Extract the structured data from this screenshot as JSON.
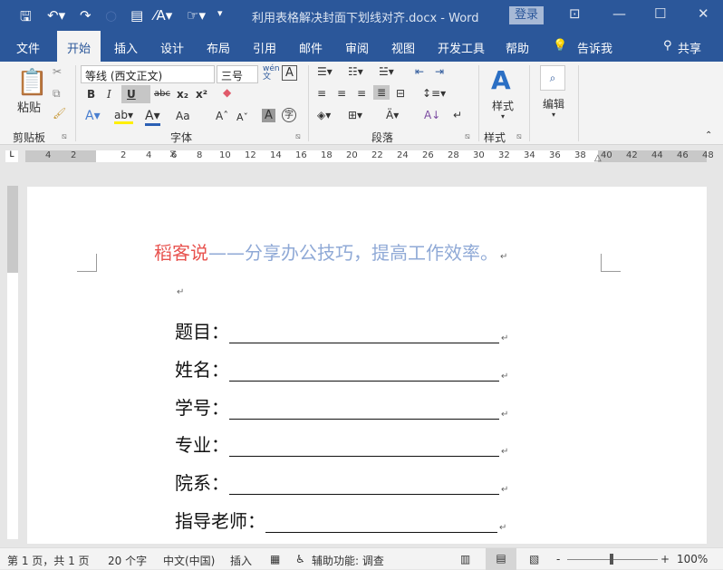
{
  "titlebar": {
    "doc_title": "利用表格解决封面下划线对齐.docx  -  Word",
    "login": "登录",
    "min": "—",
    "max": "☐",
    "close": "✕"
  },
  "tabs": [
    "文件",
    "开始",
    "插入",
    "设计",
    "布局",
    "引用",
    "邮件",
    "审阅",
    "视图",
    "开发工具",
    "帮助"
  ],
  "tell_me": "告诉我",
  "share": "共享",
  "ribbon": {
    "paste": "粘贴",
    "clipboard": "剪贴板",
    "font_name": "等线 (西文正文)",
    "font_size": "三号",
    "font_group": "字体",
    "paragraph": "段落",
    "styles": "样式",
    "styles_group": "样式",
    "edit": "编辑",
    "bold": "B",
    "italic": "I",
    "underline": "U",
    "strike": "abc",
    "sub": "x₂",
    "sup": "x²",
    "case": "Aa",
    "wen": "wén文"
  },
  "ruler": {
    "left": [
      "4",
      "2"
    ],
    "nums": [
      "2",
      "4",
      "6",
      "8",
      "10",
      "12",
      "14",
      "16",
      "18",
      "20",
      "22",
      "24",
      "26",
      "28",
      "30",
      "32",
      "34",
      "36",
      "38"
    ],
    "right": [
      "40",
      "42",
      "44",
      "46",
      "48"
    ]
  },
  "document": {
    "header_brand": "稻客说",
    "header_rest": "——分享办公技巧，提高工作效率。",
    "brand_color": "#e8534f",
    "header_color": "#8fa9d6",
    "para_mark": "↵",
    "fields": [
      {
        "label": "题目："
      },
      {
        "label": "姓名："
      },
      {
        "label": "学号："
      },
      {
        "label": "专业："
      },
      {
        "label": "院系："
      },
      {
        "label": "指导老师："
      }
    ]
  },
  "status": {
    "page": "第 1 页，共 1 页",
    "words": "20 个字",
    "lang": "中文(中国)",
    "mode": "插入",
    "access": "辅助功能: 调查",
    "zoom": "100%"
  }
}
